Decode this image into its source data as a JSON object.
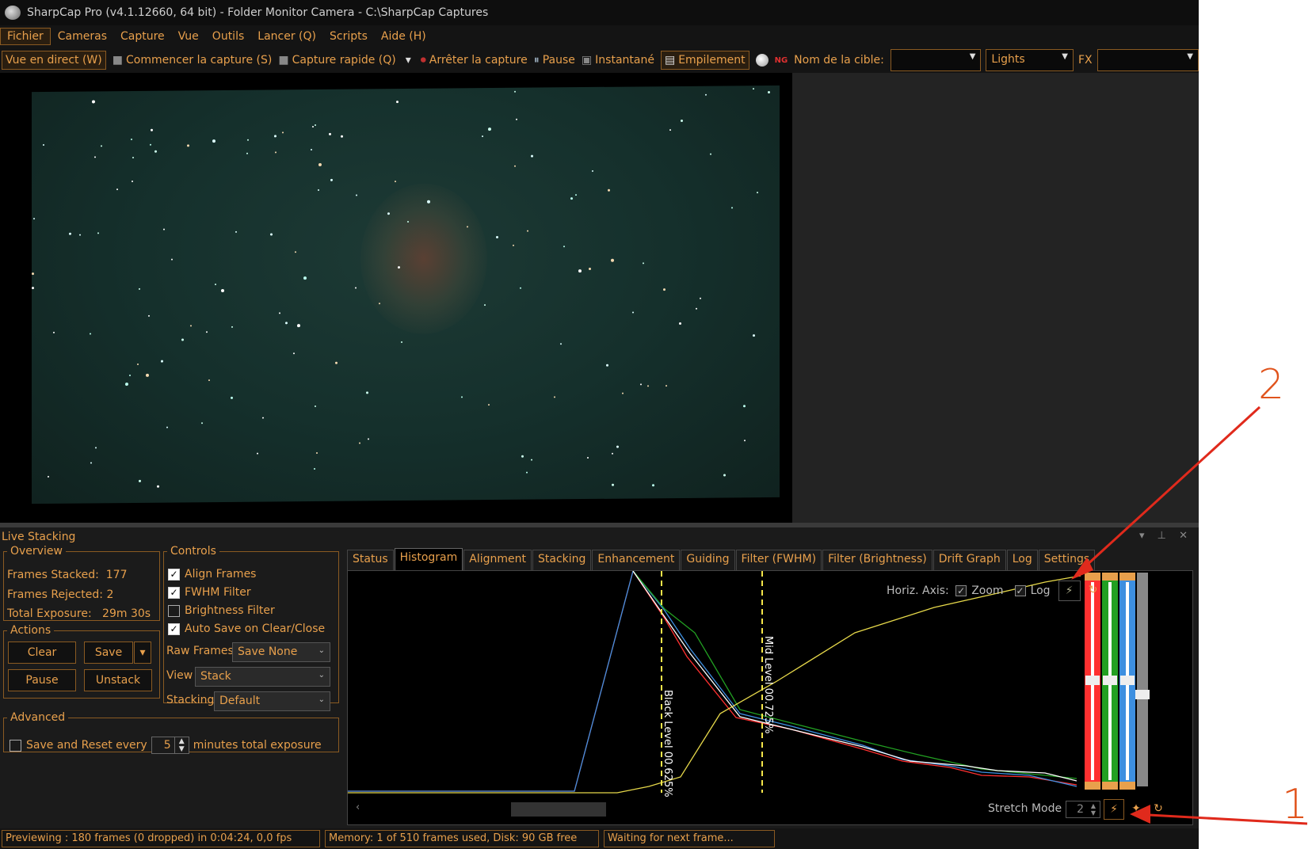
{
  "window": {
    "title": "SharpCap Pro (v4.1.12660, 64 bit) - Folder Monitor Camera - C:\\SharpCap Captures"
  },
  "menu": [
    "Fichier",
    "Cameras",
    "Capture",
    "Vue",
    "Outils",
    "Lancer (Q)",
    "Scripts",
    "Aide (H)"
  ],
  "toolbar": {
    "live_view": "Vue en direct (W)",
    "start_capture": "Commencer la capture (S)",
    "quick_capture": "Capture rapide (Q)",
    "stop_capture": "Arrêter la capture",
    "pause": "Pause",
    "snapshot": "Instantané",
    "stacking": "Empilement",
    "target_label": "Nom de la cible:",
    "target_value": "",
    "frame_type": "Lights",
    "fx_label": "FX",
    "fx_value": ""
  },
  "live_stacking": {
    "title": "Live Stacking",
    "overview": {
      "legend": "Overview",
      "frames_stacked_label": "Frames Stacked:",
      "frames_stacked": "177",
      "frames_rejected_label": "Frames Rejected:",
      "frames_rejected": "2",
      "total_exposure_label": "Total Exposure:",
      "total_exposure": "29m 30s"
    },
    "actions": {
      "legend": "Actions",
      "clear": "Clear",
      "save": "Save",
      "pause": "Pause",
      "unstack": "Unstack"
    },
    "controls": {
      "legend": "Controls",
      "align_frames": "Align Frames",
      "fwhm_filter": "FWHM Filter",
      "brightness_filter": "Brightness Filter",
      "auto_save": "Auto Save on Clear/Close",
      "raw_frames_label": "Raw Frames",
      "raw_frames_value": "Save None",
      "view_label": "View",
      "view_value": "Stack",
      "stacking_label": "Stacking",
      "stacking_value": "Default"
    },
    "advanced": {
      "legend": "Advanced",
      "save_reset_label": "Save and Reset every",
      "minutes_value": "5",
      "minutes_label": "minutes total exposure"
    },
    "tabs": [
      "Status",
      "Histogram",
      "Alignment",
      "Stacking",
      "Enhancement",
      "Guiding",
      "Filter (FWHM)",
      "Filter (Brightness)",
      "Drift Graph",
      "Log",
      "Settings"
    ],
    "active_tab": "Histogram",
    "histogram": {
      "horiz_axis_label": "Horiz. Axis:",
      "zoom_label": "Zoom",
      "log_label": "Log",
      "black_level": "Black Level  00.625%",
      "mid_level": "Mid Level  00.725%",
      "stretch_mode_label": "Stretch Mode",
      "stretch_mode_value": "2",
      "colors": {
        "red": "#ff3030",
        "green": "#22a022",
        "blue": "#3d8fe0",
        "white": "#ffffff",
        "yellow": "#e6d84a",
        "level": "#f5e64a"
      }
    }
  },
  "status": {
    "preview": "Previewing : 180 frames (0 dropped) in 0:04:24, 0,0 fps",
    "memory": "Memory: 1 of 510 frames used, Disk: 90 GB free",
    "waiting": "Waiting for next frame..."
  },
  "annotations": {
    "one": "1",
    "two": "2"
  }
}
